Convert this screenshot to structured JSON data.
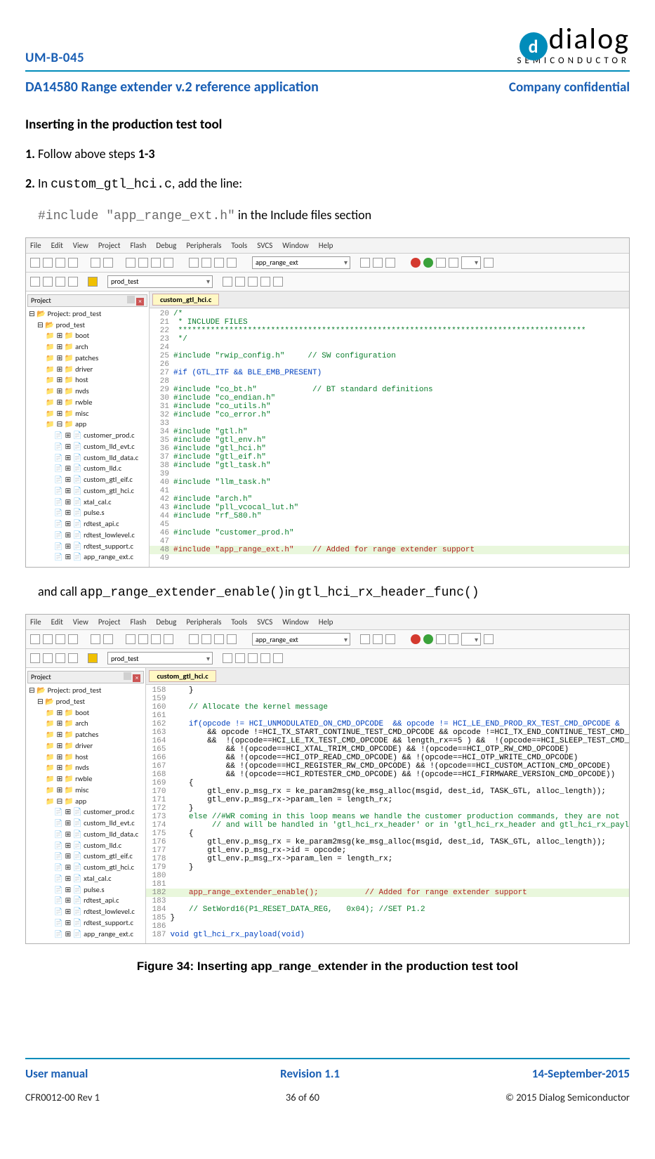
{
  "header": {
    "doc_code": "UM-B-045",
    "logo_word": "dialog",
    "logo_sub": "SEMICONDUCTOR",
    "title": "DA14580 Range extender v.2 reference application",
    "confidential": "Company confidential"
  },
  "content": {
    "section_heading": "Inserting in the production test tool",
    "step1_prefix": "1. ",
    "step1_a": "Follow above steps ",
    "step1_b": "1-3",
    "step2_prefix": "2. ",
    "step2_a": "In ",
    "step2_file": "custom_gtl_hci.c",
    "step2_b": ", add the line:",
    "include_code": "#include \"app_range_ext.h\"",
    "include_tail": " in the Include files section",
    "mid_a": "and call ",
    "mid_code1": "app_range_extender_enable()",
    "mid_b": "in ",
    "mid_code2": "gtl_hci_rx_header_func()",
    "figure_caption": "Figure 34: Inserting app_range_extender in the production test tool"
  },
  "ide_common": {
    "menu": [
      "File",
      "Edit",
      "View",
      "Project",
      "Flash",
      "Debug",
      "Peripherals",
      "Tools",
      "SVCS",
      "Window",
      "Help"
    ],
    "dropdown1": "prod_test",
    "dropdown2": "app_range_ext",
    "project_panel_label": "Project",
    "filetab": "custom_gtl_hci.c",
    "tree": {
      "root": "Project: prod_test",
      "target": "prod_test",
      "folders": [
        "boot",
        "arch",
        "patches",
        "driver",
        "host",
        "nvds",
        "rwble",
        "misc",
        "app"
      ],
      "app_files": [
        "customer_prod.c",
        "custom_lld_evt.c",
        "custom_lld_data.c",
        "custom_lld.c",
        "custom_gtl_eif.c",
        "custom_gtl_hci.c",
        "xtal_cal.c",
        "pulse.s",
        "rdtest_api.c",
        "rdtest_lowlevel.c",
        "rdtest_support.c",
        "app_range_ext.c"
      ]
    }
  },
  "code_a_start": 20,
  "code_a_lines": [
    {
      "t": "/*",
      "cls": "c-green"
    },
    {
      "t": " * INCLUDE FILES",
      "cls": "c-green"
    },
    {
      "t": " ****************************************************************************************",
      "cls": "c-green"
    },
    {
      "t": " */",
      "cls": "c-green"
    },
    {
      "t": ""
    },
    {
      "t": "#include \"rwip_config.h\"     // SW configuration",
      "cls": "c-green"
    },
    {
      "t": ""
    },
    {
      "t": "#if (GTL_ITF && BLE_EMB_PRESENT)",
      "cls": "c-kw"
    },
    {
      "t": ""
    },
    {
      "t": "#include \"co_bt.h\"            // BT standard definitions",
      "cls": "c-green"
    },
    {
      "t": "#include \"co_endian.h\"",
      "cls": "c-green"
    },
    {
      "t": "#include \"co_utils.h\"",
      "cls": "c-green"
    },
    {
      "t": "#include \"co_error.h\"",
      "cls": "c-green"
    },
    {
      "t": ""
    },
    {
      "t": "#include \"gtl.h\"",
      "cls": "c-green"
    },
    {
      "t": "#include \"gtl_env.h\"",
      "cls": "c-green"
    },
    {
      "t": "#include \"gtl_hci.h\"",
      "cls": "c-green"
    },
    {
      "t": "#include \"gtl_eif.h\"",
      "cls": "c-green"
    },
    {
      "t": "#include \"gtl_task.h\"",
      "cls": "c-green"
    },
    {
      "t": ""
    },
    {
      "t": "#include \"llm_task.h\"",
      "cls": "c-green"
    },
    {
      "t": ""
    },
    {
      "t": "#include \"arch.h\"",
      "cls": "c-green"
    },
    {
      "t": "#include \"pll_vcocal_lut.h\"",
      "cls": "c-green"
    },
    {
      "t": "#include \"rf_580.h\"",
      "cls": "c-green"
    },
    {
      "t": ""
    },
    {
      "t": "#include \"customer_prod.h\"",
      "cls": "c-green"
    },
    {
      "t": ""
    },
    {
      "t": "#include \"app_range_ext.h\"    // Added for range extender support",
      "cls": "c-red",
      "hl": true
    },
    {
      "t": ""
    }
  ],
  "code_b_start": 158,
  "code_b_lines": [
    {
      "t": "    }"
    },
    {
      "t": ""
    },
    {
      "t": "    // Allocate the kernel message",
      "cls": "c-green"
    },
    {
      "t": ""
    },
    {
      "t": "    if(opcode != HCI_UNMODULATED_ON_CMD_OPCODE  && opcode != HCI_LE_END_PROD_RX_TEST_CMD_OPCODE &",
      "cls": "c-kw"
    },
    {
      "t": "        && opcode !=HCI_TX_START_CONTINUE_TEST_CMD_OPCODE && opcode !=HCI_TX_END_CONTINUE_TEST_CMD_",
      "cls": ""
    },
    {
      "t": "        &&  !(opcode==HCI_LE_TX_TEST_CMD_OPCODE && length_rx==5 ) &&  !(opcode==HCI_SLEEP_TEST_CMD_",
      "cls": ""
    },
    {
      "t": "            && !(opcode==HCI_XTAL_TRIM_CMD_OPCODE) && !(opcode==HCI_OTP_RW_CMD_OPCODE)",
      "cls": ""
    },
    {
      "t": "            && !(opcode==HCI_OTP_READ_CMD_OPCODE) && !(opcode==HCI_OTP_WRITE_CMD_OPCODE)",
      "cls": ""
    },
    {
      "t": "            && !(opcode==HCI_REGISTER_RW_CMD_OPCODE) && !(opcode==HCI_CUSTOM_ACTION_CMD_OPCODE)",
      "cls": ""
    },
    {
      "t": "            && !(opcode==HCI_RDTESTER_CMD_OPCODE) && !(opcode==HCI_FIRMWARE_VERSION_CMD_OPCODE))",
      "cls": ""
    },
    {
      "t": "    {"
    },
    {
      "t": "        gtl_env.p_msg_rx = ke_param2msg(ke_msg_alloc(msgid, dest_id, TASK_GTL, alloc_length));"
    },
    {
      "t": "        gtl_env.p_msg_rx->param_len = length_rx;"
    },
    {
      "t": "    }"
    },
    {
      "t": "    else //#WR coming in this loop means we handle the customer production commands, they are not",
      "cls": "c-green"
    },
    {
      "t": "         // and will be handled in 'gtl_hci_rx_header' or in 'gtl_hci_rx_header and gtl_hci_rx_payl",
      "cls": "c-green"
    },
    {
      "t": "    {"
    },
    {
      "t": "        gtl_env.p_msg_rx = ke_param2msg(ke_msg_alloc(msgid, dest_id, TASK_GTL, alloc_length));"
    },
    {
      "t": "        gtl_env.p_msg_rx->id = opcode;"
    },
    {
      "t": "        gtl_env.p_msg_rx->param_len = length_rx;"
    },
    {
      "t": "    }"
    },
    {
      "t": ""
    },
    {
      "t": ""
    },
    {
      "t": "    app_range_extender_enable();          // Added for range extender support",
      "cls": "c-red",
      "hl": true
    },
    {
      "t": ""
    },
    {
      "t": "    // SetWord16(P1_RESET_DATA_REG,   0x04); //SET P1.2",
      "cls": "c-green"
    },
    {
      "t": "}"
    },
    {
      "t": ""
    },
    {
      "t": "void gtl_hci_rx_payload(void)",
      "cls": "c-kw"
    }
  ],
  "footer": {
    "left1": "User manual",
    "mid1": "Revision 1.1",
    "right1": "14-September-2015",
    "left2": "CFR0012-00 Rev 1",
    "mid2": "36 of 60",
    "right2": "© 2015 Dialog Semiconductor"
  }
}
